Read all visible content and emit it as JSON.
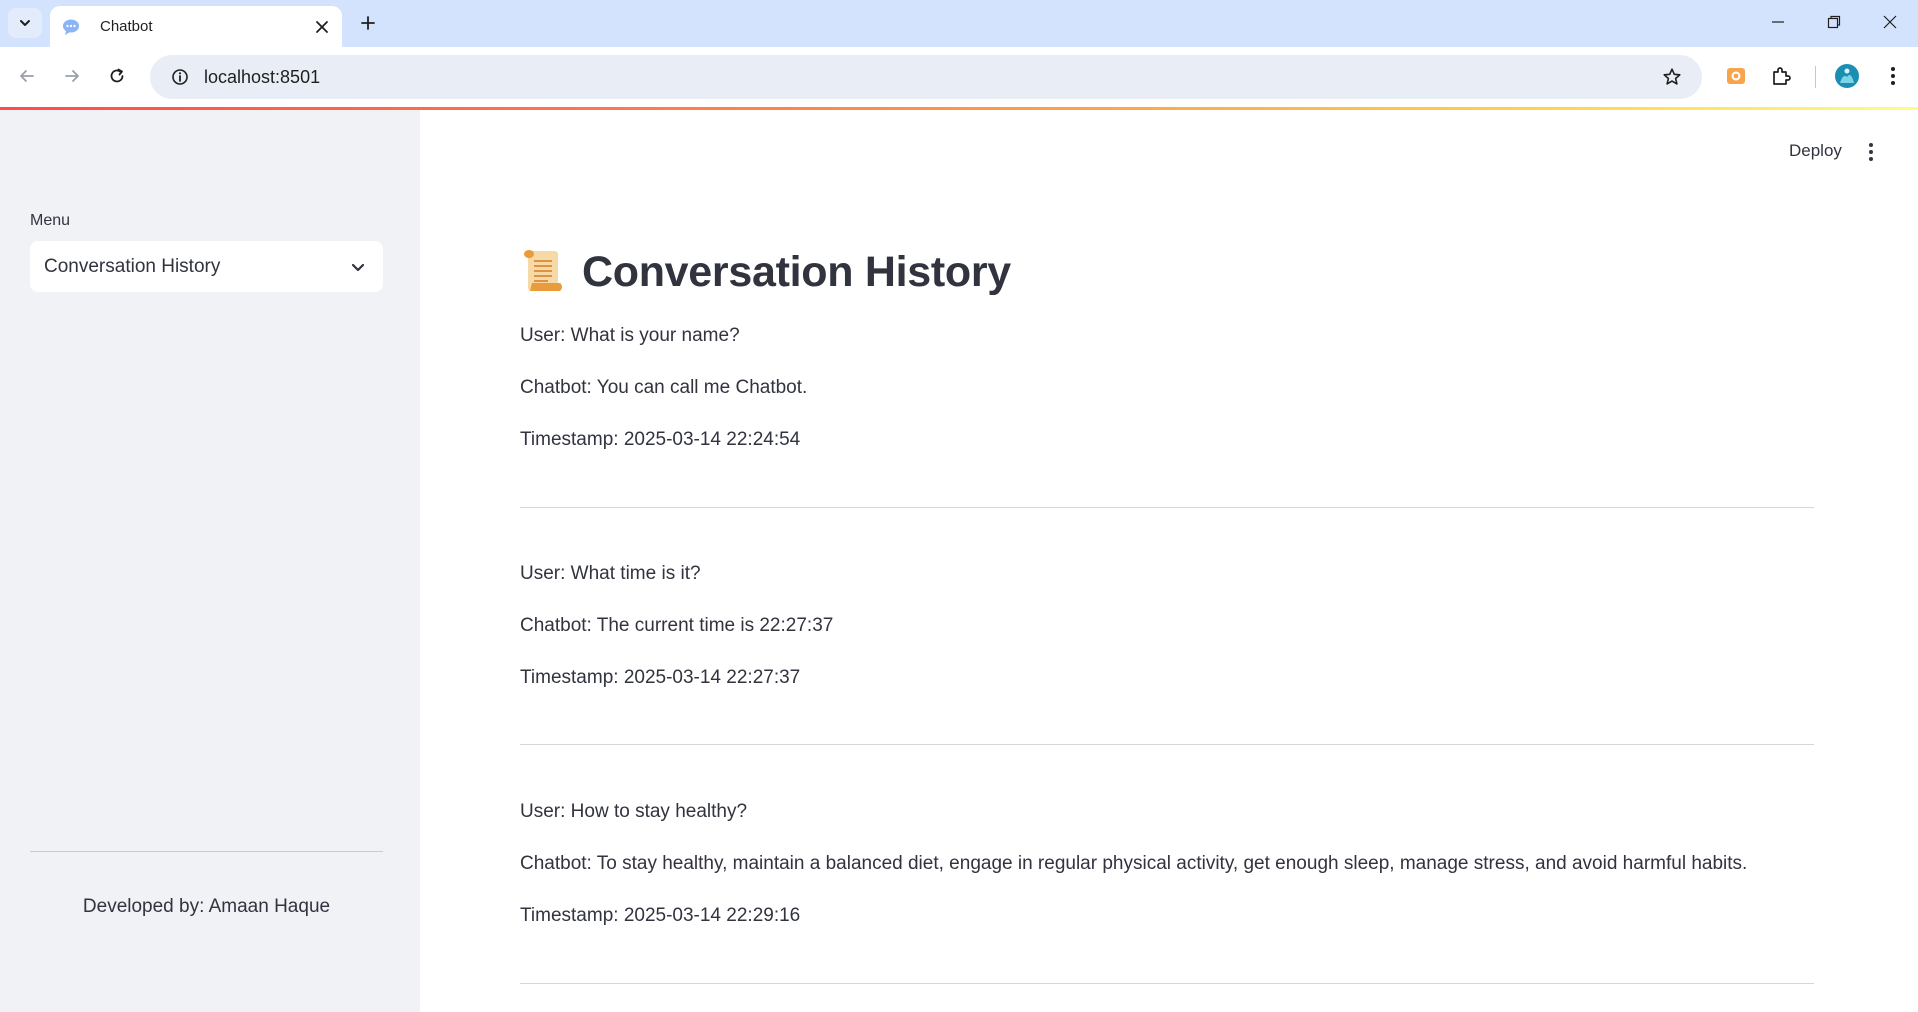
{
  "browser": {
    "tab_title": "Chatbot",
    "url": "localhost:8501"
  },
  "sidebar": {
    "menu_label": "Menu",
    "selected_option": "Conversation History",
    "credit": "Developed by: Amaan Haque"
  },
  "header": {
    "deploy_label": "Deploy"
  },
  "main": {
    "title_emoji": "scroll-icon",
    "title": "Conversation History",
    "conversations": [
      {
        "user": "User: What is your name?",
        "bot": "Chatbot: You can call me Chatbot.",
        "timestamp": "Timestamp: 2025-03-14 22:24:54"
      },
      {
        "user": "User: What time is it?",
        "bot": "Chatbot: The current time is 22:27:37",
        "timestamp": "Timestamp: 2025-03-14 22:27:37"
      },
      {
        "user": "User: How to stay healthy?",
        "bot": "Chatbot: To stay healthy, maintain a balanced diet, engage in regular physical activity, get enough sleep, manage stress, and avoid harmful habits.",
        "timestamp": "Timestamp: 2025-03-14 22:29:16"
      }
    ]
  },
  "colors": {
    "accent_red": "#ff4b4b",
    "sidebar_bg": "#f0f2f6",
    "text": "#31333f",
    "tabstrip_bg": "#d3e3fd"
  }
}
